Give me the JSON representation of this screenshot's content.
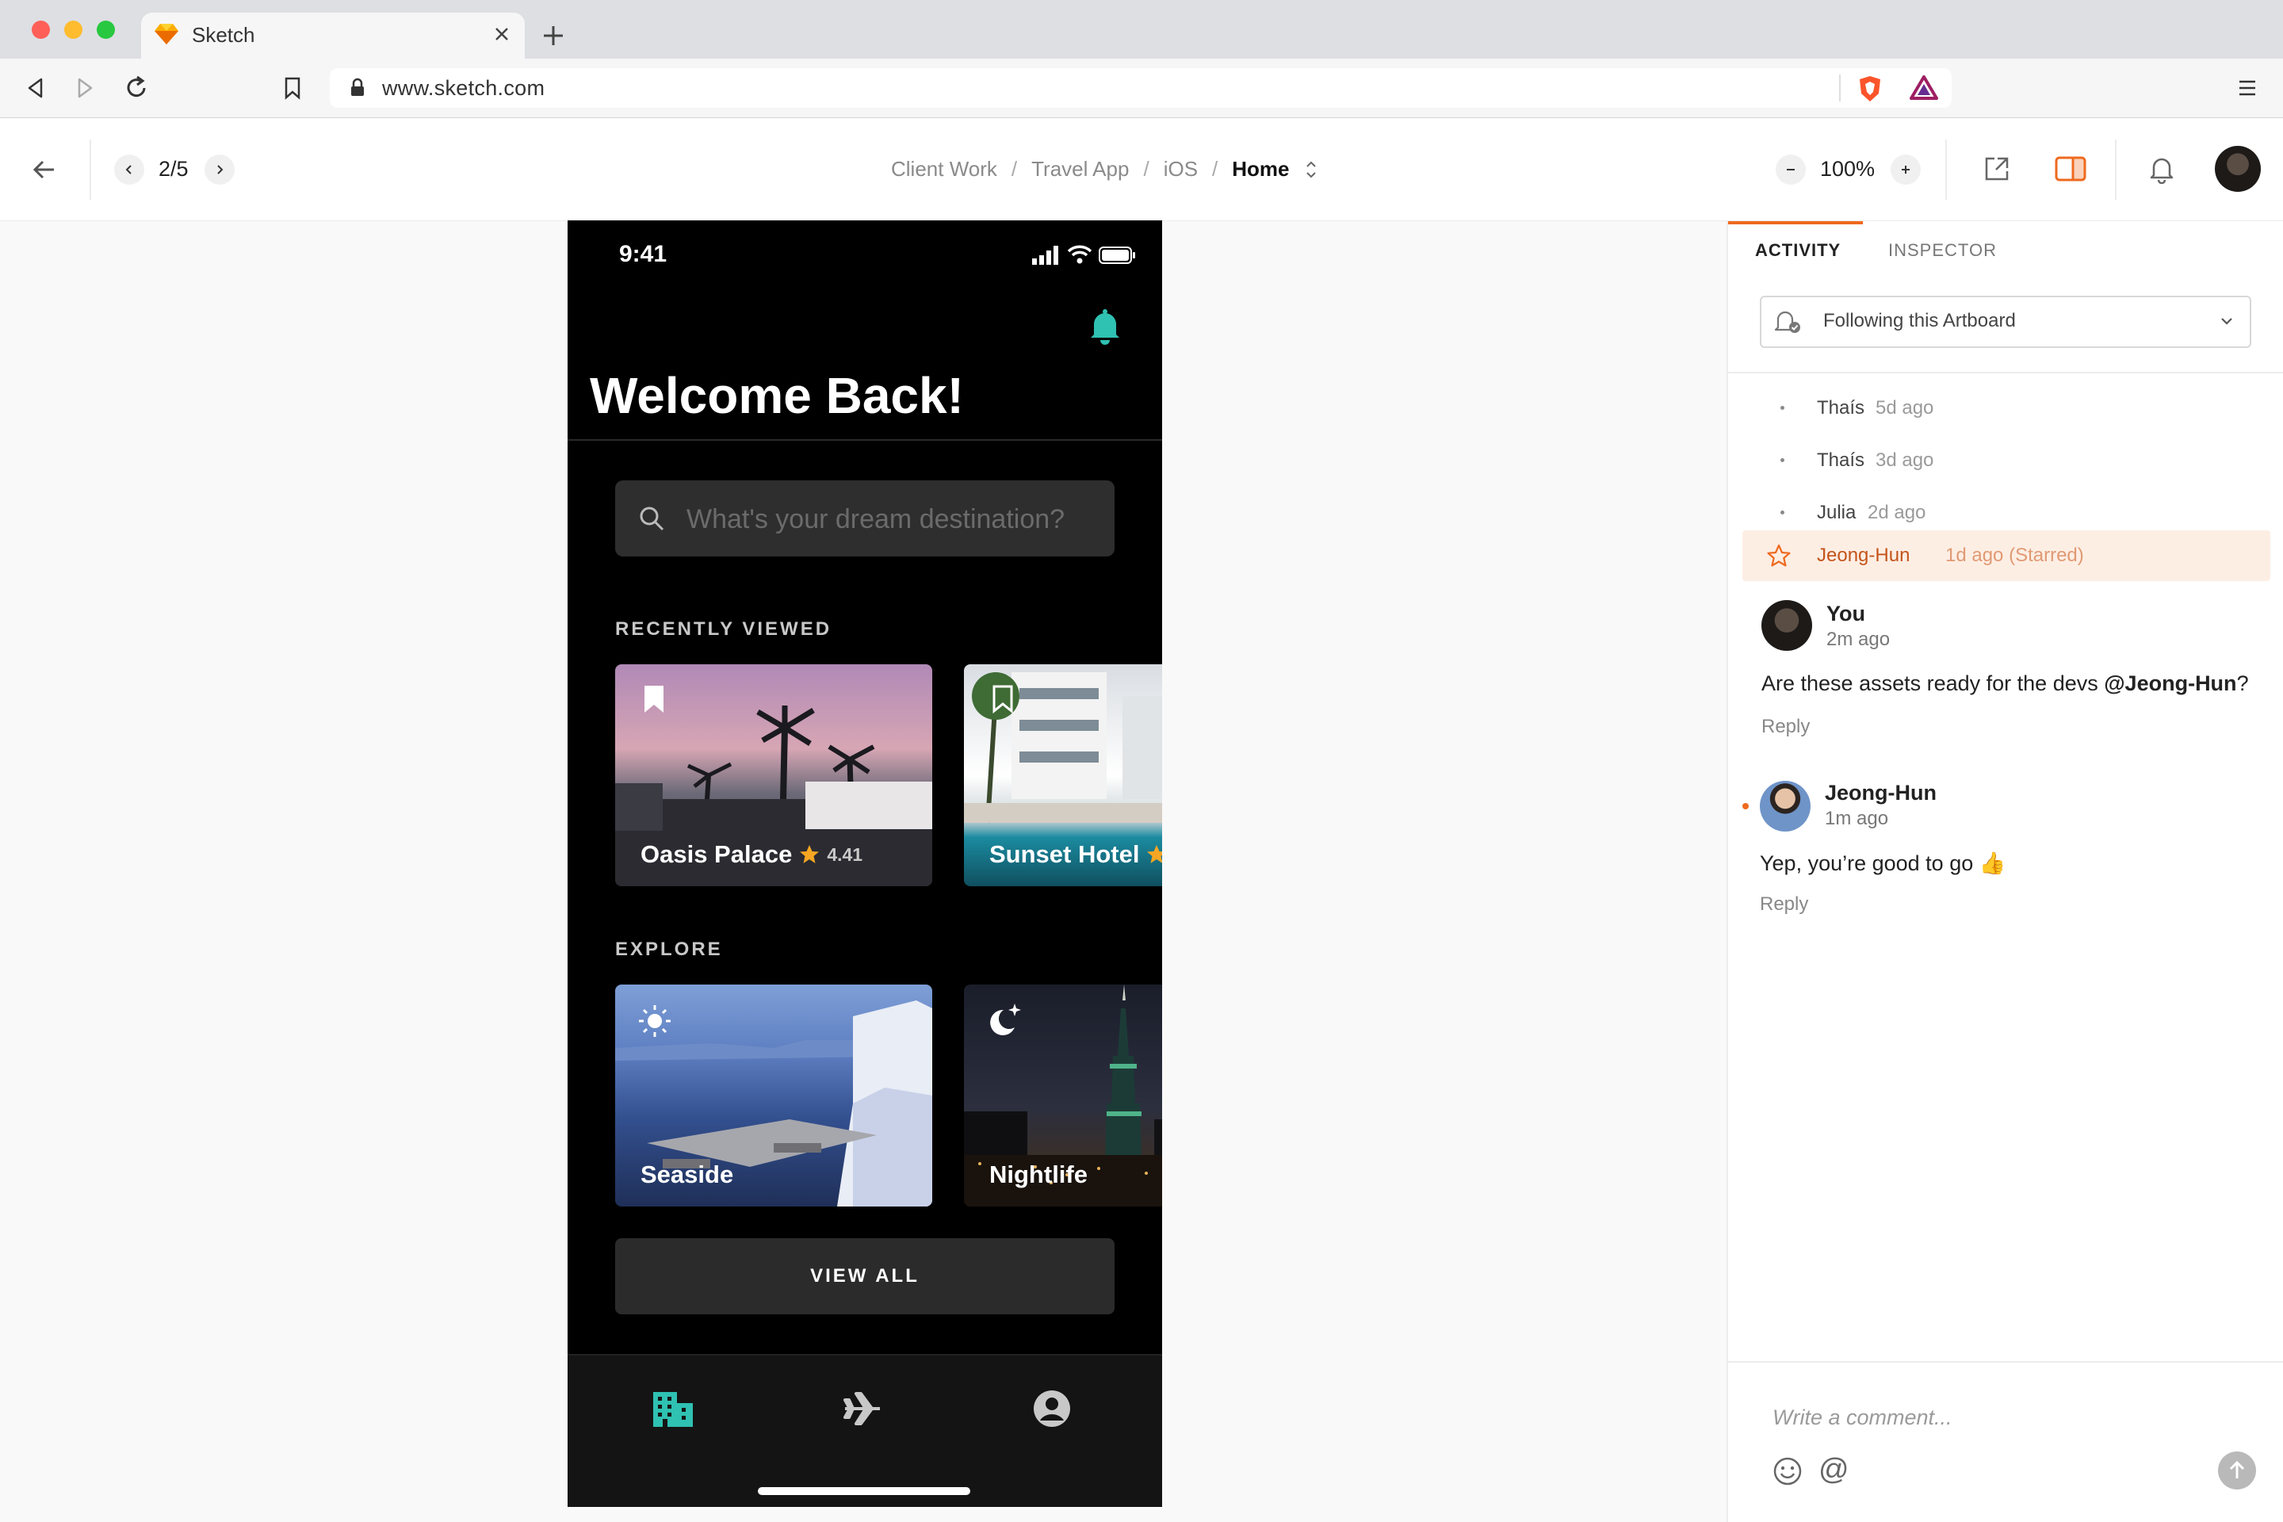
{
  "browser": {
    "tab_title": "Sketch",
    "url": "www.sketch.com",
    "colors": {
      "close": "#ff5f57",
      "minimize": "#febc2e",
      "maximize": "#28c840"
    }
  },
  "header": {
    "page_indicator": "2/5",
    "breadcrumb": [
      "Client Work",
      "Travel App",
      "iOS",
      "Home"
    ],
    "separator": "/",
    "zoom": "100%"
  },
  "phone": {
    "time": "9:41",
    "greeting": "Welcome Back!",
    "search_placeholder": "What's your dream destination?",
    "recently_viewed_label": "RECENTLY VIEWED",
    "recent": [
      {
        "name": "Oasis Palace",
        "rating": "4.41"
      },
      {
        "name": "Sunset Hotel"
      }
    ],
    "explore_label": "EXPLORE",
    "explore": [
      {
        "name": "Seaside",
        "icon": "sun-icon"
      },
      {
        "name": "Nightlife",
        "icon": "moon-stars-icon"
      }
    ],
    "view_all": "VIEW ALL",
    "accent": "#2fc1b2"
  },
  "panel": {
    "tabs": [
      "ACTIVITY",
      "INSPECTOR"
    ],
    "follow_label": "Following this Artboard",
    "activity": [
      {
        "name": "Thaís",
        "time": "5d ago"
      },
      {
        "name": "Thaís",
        "time": "3d ago"
      },
      {
        "name": "Julia",
        "time": "2d ago"
      },
      {
        "name": "Jeong-Hun",
        "time": "1d ago (Starred)"
      }
    ],
    "comments": [
      {
        "name": "You",
        "time": "2m ago",
        "text": "Are these assets ready for the devs ",
        "mention": "@Jeong-Hun",
        "suffix": "?",
        "reply": "Reply"
      },
      {
        "name": "Jeong-Hun",
        "time": "1m ago",
        "text": "Yep, you’re good to go 👍",
        "reply": "Reply"
      }
    ],
    "comment_placeholder": "Write a comment...",
    "at_symbol": "@",
    "accent": "#ee6a1f"
  }
}
